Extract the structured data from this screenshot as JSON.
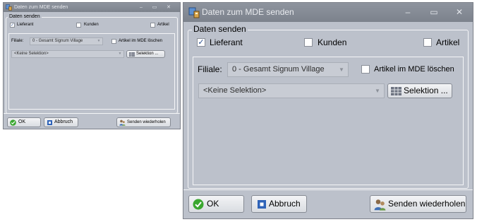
{
  "window": {
    "title": "Daten zum MDE senden",
    "minimize_glyph": "–",
    "maximize_glyph": "▭",
    "close_glyph": "✕"
  },
  "group": {
    "legend": "Daten senden"
  },
  "checkboxes": {
    "lieferant": {
      "label": "Lieferant",
      "checked": true
    },
    "kunden": {
      "label": "Kunden",
      "checked": false
    },
    "artikel": {
      "label": "Artikel",
      "checked": false
    },
    "artikel_loeschen": {
      "label": "Artikel im MDE löschen",
      "checked": false
    }
  },
  "filiale": {
    "label": "Filiale:",
    "value": "0 - Gesamt Signum Village"
  },
  "selection": {
    "value": "<Keine Selektion>",
    "button_label": "Selektion ..."
  },
  "buttons": {
    "ok": "OK",
    "abbruch": "Abbruch",
    "senden": "Senden wiederholen"
  },
  "colors": {
    "window_bg": "#bcc1cb",
    "titlebar": "#848a94",
    "check_tick": "#2b4f8f",
    "ok_icon": "#3aa72f",
    "abbruch_icon": "#2f63b8"
  },
  "icons": {
    "app": "computer-phone-icon",
    "ok": "green-check-icon",
    "abbruch": "blue-box-icon",
    "senden": "people-icon",
    "selektion": "grid-icon",
    "dropdown": "chevron-down-icon"
  }
}
